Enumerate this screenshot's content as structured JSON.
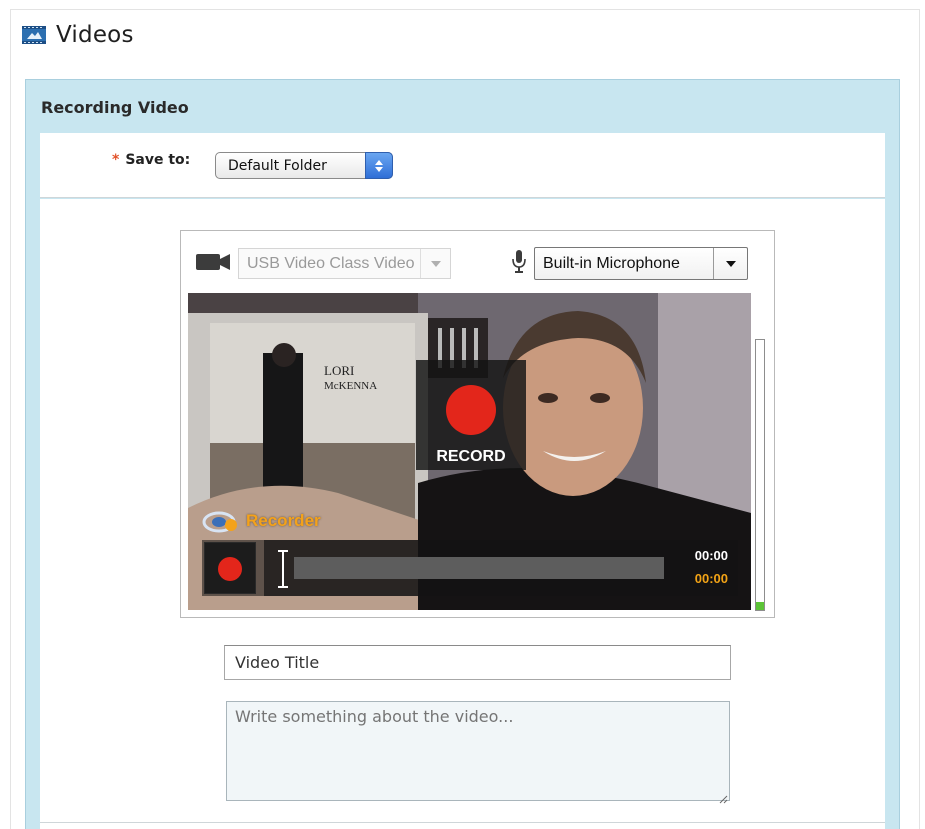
{
  "page": {
    "title": "Videos",
    "icon": "video-film-icon"
  },
  "panel": {
    "title": "Recording Video"
  },
  "save_to": {
    "required_marker": "*",
    "label": "Save to:",
    "selected": "Default Folder"
  },
  "recorder": {
    "camera_select": {
      "icon": "video-camera-icon",
      "value": "USB Video Class Video",
      "disabled": true
    },
    "mic_select": {
      "icon": "microphone-icon",
      "value": "Built-in Microphone"
    },
    "record_overlay_label": "RECORD",
    "brand_label": "Recorder",
    "brand_icon": "recorder-logo-icon",
    "elapsed_time": "00:00",
    "recorded_time": "00:00",
    "progress_fraction": 0,
    "audio_level_fraction": 0.03
  },
  "form": {
    "title_value": "Video Title",
    "description_placeholder": "Write something about the video..."
  },
  "colors": {
    "panel_background": "#c8e6f0",
    "record_red": "#e3261b",
    "time_accent": "#f2a316",
    "brand_orange": "#f4a21a",
    "level_green": "#5cc437"
  }
}
